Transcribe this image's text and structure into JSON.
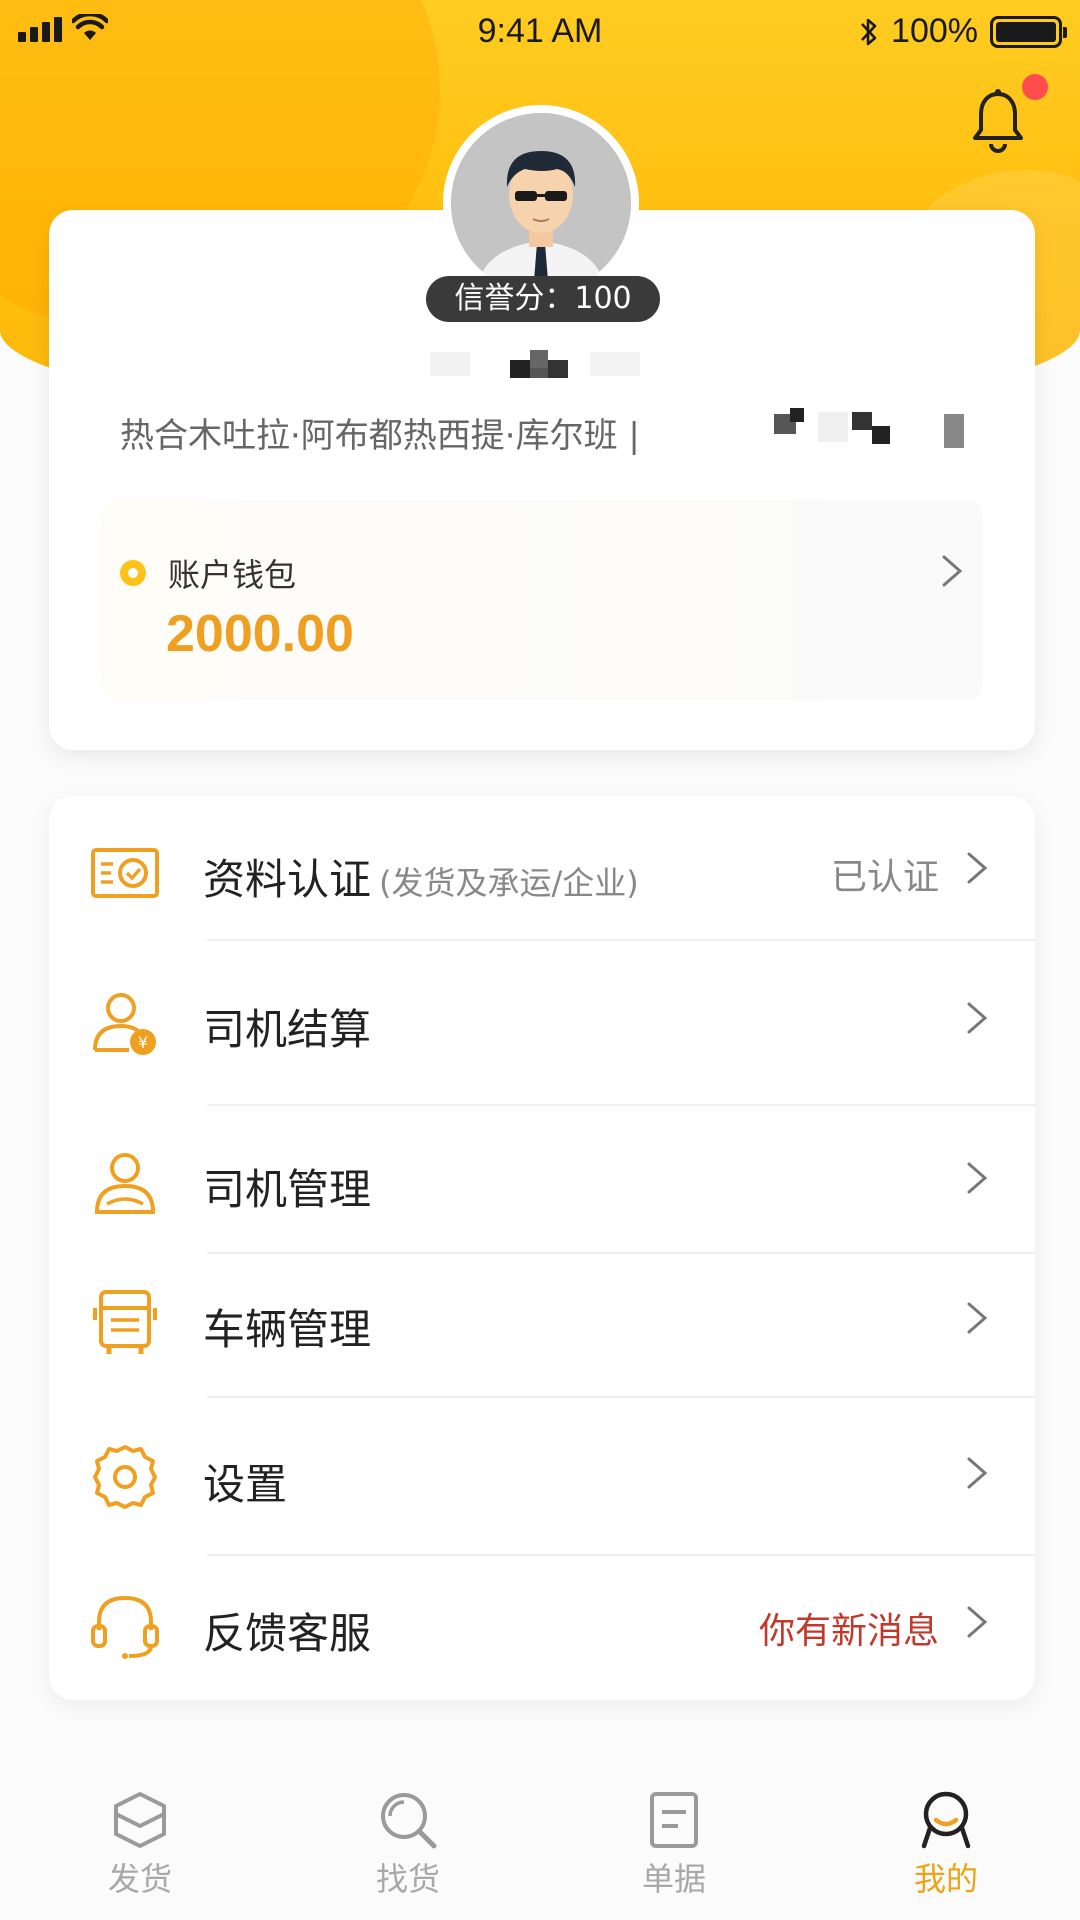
{
  "status_bar": {
    "time": "9:41 AM",
    "battery": "100%",
    "icons": [
      "signal-icon",
      "wifi-icon",
      "bluetooth-icon",
      "battery-icon"
    ]
  },
  "header": {
    "notification_icon": "bell-icon",
    "has_unread": true
  },
  "profile": {
    "credit_label": "信誉分：",
    "credit_score": "100",
    "company": "热合木吐拉·阿布都热西提·库尔班 |"
  },
  "wallet": {
    "label": "账户钱包",
    "amount": "2000.00"
  },
  "menu": {
    "items": [
      {
        "label": "资料认证",
        "sub": "(发货及承运/企业)",
        "status": "已认证",
        "icon": "certificate-icon"
      },
      {
        "label": "司机结算",
        "sub": "",
        "status": "",
        "icon": "driver-settlement-icon"
      },
      {
        "label": "司机管理",
        "sub": "",
        "status": "",
        "icon": "driver-icon"
      },
      {
        "label": "车辆管理",
        "sub": "",
        "status": "",
        "icon": "truck-icon"
      },
      {
        "label": "设置",
        "sub": "",
        "status": "",
        "icon": "gear-icon"
      },
      {
        "label": "反馈客服",
        "sub": "",
        "status": "你有新消息",
        "icon": "headset-icon"
      }
    ]
  },
  "tabs": [
    {
      "label": "发货",
      "icon": "box-icon",
      "active": false
    },
    {
      "label": "找货",
      "icon": "search-icon",
      "active": false
    },
    {
      "label": "单据",
      "icon": "document-icon",
      "active": false
    },
    {
      "label": "我的",
      "icon": "profile-icon",
      "active": true
    }
  ],
  "colors": {
    "brand_yellow": "#ffc21a",
    "accent_orange": "#e9a418",
    "alert_red": "#c0392b"
  }
}
